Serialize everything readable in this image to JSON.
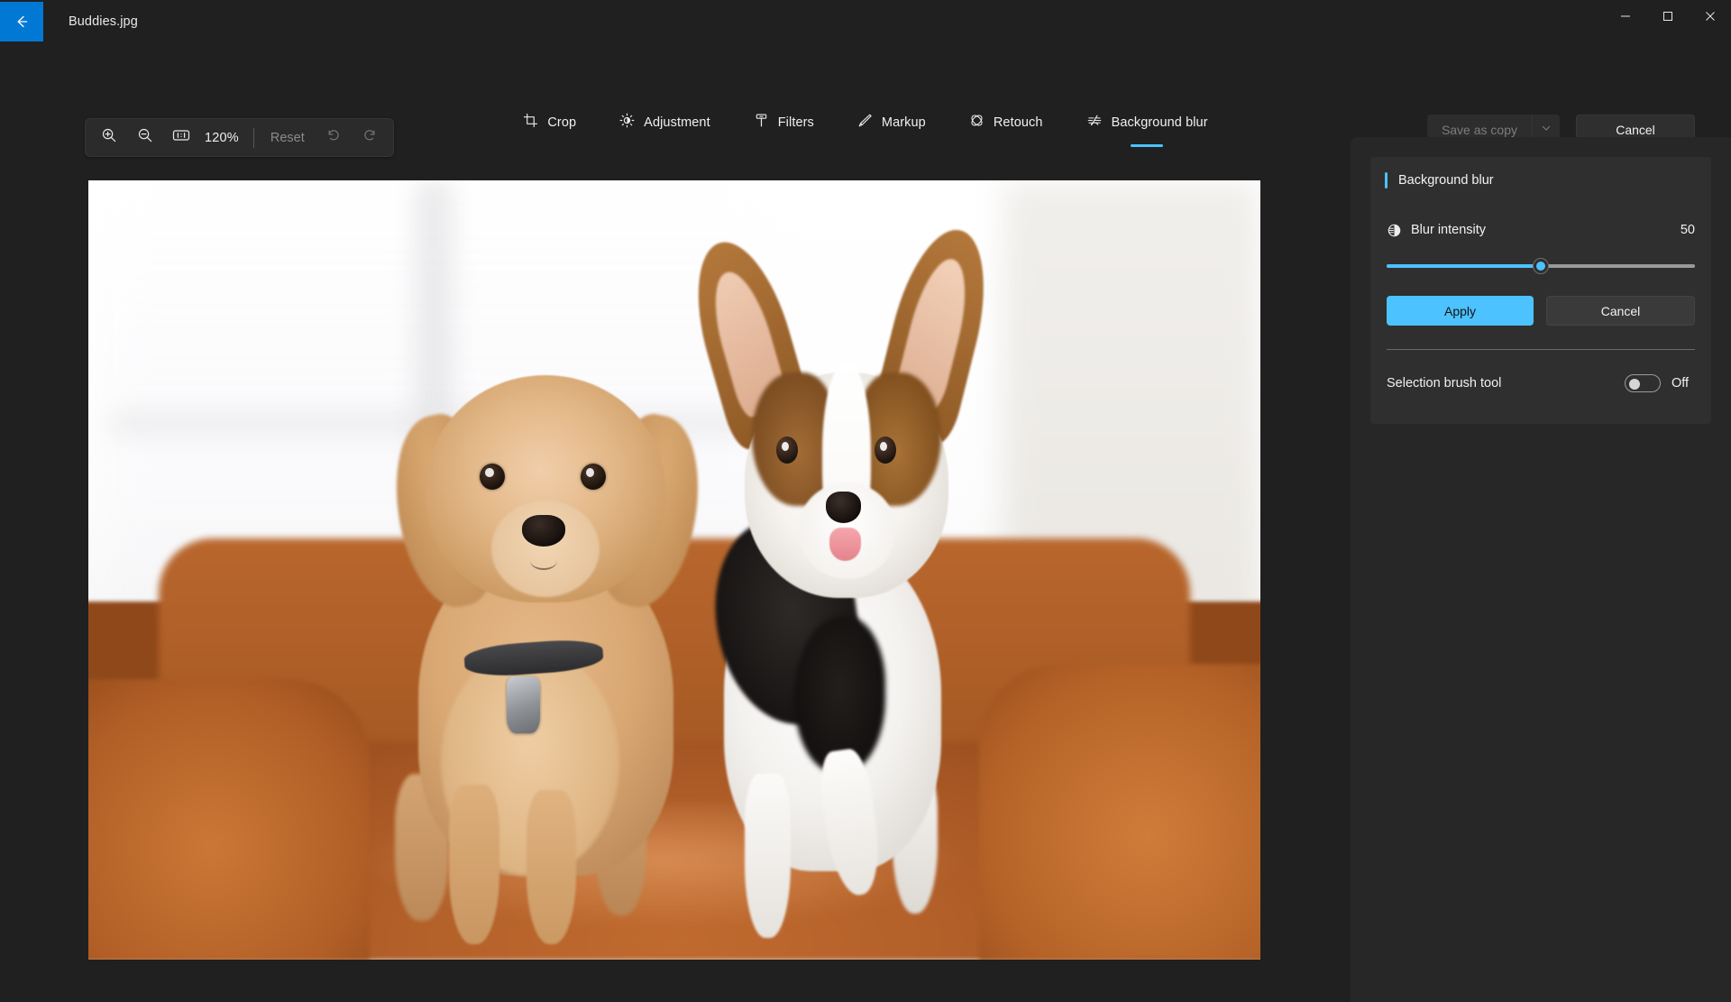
{
  "window": {
    "title": "Buddies.jpg",
    "back_icon": "arrow-left-icon",
    "controls": [
      {
        "name": "minimize",
        "icon": "minimize-icon"
      },
      {
        "name": "maximize",
        "icon": "maximize-icon"
      },
      {
        "name": "close",
        "icon": "close-icon"
      }
    ]
  },
  "zoom_toolbar": {
    "zoom_in_icon": "zoom-in-icon",
    "zoom_out_icon": "zoom-out-icon",
    "fit_icon": "actual-size-icon",
    "zoom_level": "120%",
    "reset_label": "Reset",
    "undo_icon": "undo-icon",
    "redo_icon": "redo-icon"
  },
  "tabs": [
    {
      "label": "Crop",
      "icon": "crop-icon",
      "active": false
    },
    {
      "label": "Adjustment",
      "icon": "brightness-icon",
      "active": false
    },
    {
      "label": "Filters",
      "icon": "filters-icon",
      "active": false
    },
    {
      "label": "Markup",
      "icon": "pen-icon",
      "active": false
    },
    {
      "label": "Retouch",
      "icon": "retouch-icon",
      "active": false
    },
    {
      "label": "Background blur",
      "icon": "blur-icon",
      "active": true
    }
  ],
  "actions": {
    "save_as_copy_label": "Save as copy",
    "save_chevron_icon": "chevron-down-icon",
    "cancel_label": "Cancel"
  },
  "panel": {
    "title": "Background blur",
    "accent_color": "#4cc2ff",
    "intensity": {
      "icon": "contrast-circle-icon",
      "label": "Blur intensity",
      "value": "50",
      "percent": 50
    },
    "apply_label": "Apply",
    "cancel_label": "Cancel",
    "brush": {
      "label": "Selection brush tool",
      "state": "Off",
      "enabled": false
    }
  },
  "image": {
    "alt": "Two puppies — a cream doodle and a corgi — standing on an orange leather armchair"
  }
}
